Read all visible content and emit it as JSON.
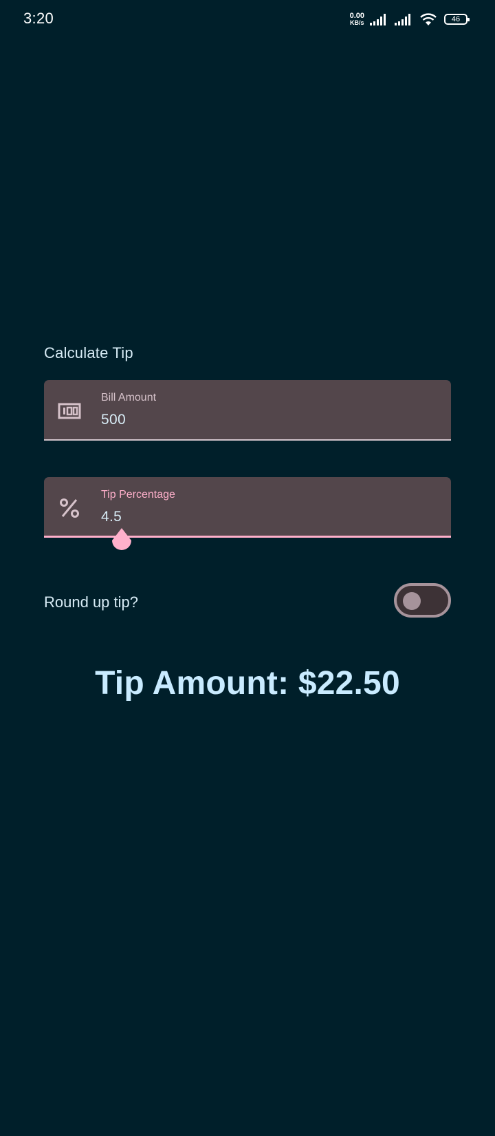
{
  "status_bar": {
    "time": "3:20",
    "net_speed_value": "0.00",
    "net_speed_unit": "KB/s",
    "battery": "46"
  },
  "screen": {
    "title": "Calculate Tip",
    "bill_field": {
      "label": "Bill Amount",
      "value": "500",
      "icon": "money-icon"
    },
    "tip_field": {
      "label": "Tip Percentage",
      "value": "4.5",
      "icon": "percent-icon"
    },
    "round_up": {
      "label": "Round up tip?",
      "checked": false
    },
    "tip_amount": "Tip Amount: $22.50"
  },
  "colors": {
    "background": "#001f2a",
    "field_background": "#53464b",
    "accent": "#ffb0cb",
    "text": "#d8ecf6",
    "result_text": "#c9ebff"
  }
}
